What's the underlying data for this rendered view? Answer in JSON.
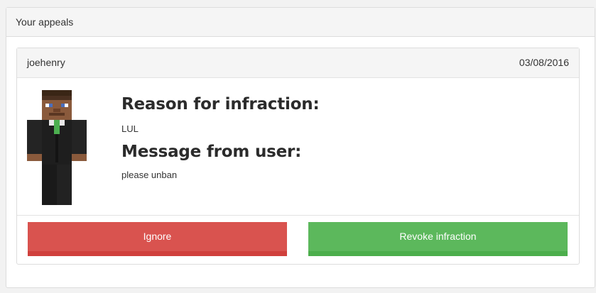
{
  "panel": {
    "title": "Your appeals"
  },
  "appeal": {
    "username": "joehenry",
    "date": "03/08/2016",
    "reason_heading": "Reason for infraction:",
    "reason": "LUL",
    "message_heading": "Message from user:",
    "message": "please unban",
    "ignore_label": "Ignore",
    "revoke_label": "Revoke infraction"
  },
  "colors": {
    "ignore": "#d9534f",
    "revoke": "#5cb85c"
  }
}
